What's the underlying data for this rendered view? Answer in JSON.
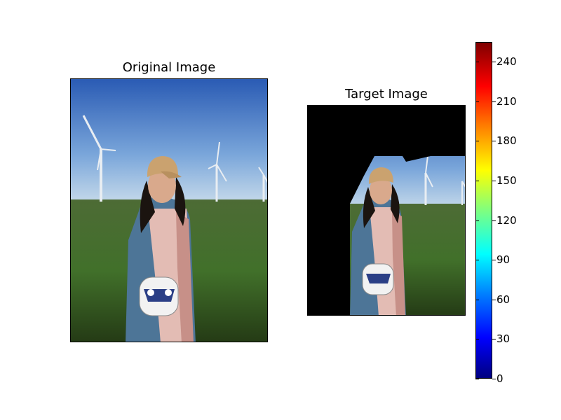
{
  "chart_data": [
    {
      "type": "image",
      "title": "Original Image",
      "content": "photo of a woman wearing a beige cap and a blue cardigan, holding a white bag, standing in a green field with wind turbines under a blue sky"
    },
    {
      "type": "image",
      "title": "Target Image",
      "content": "same photo cropped; left and upper-left region masked to black"
    },
    {
      "type": "colorbar",
      "colormap": "jet",
      "range": [
        0,
        255
      ],
      "ticks": [
        0,
        30,
        60,
        90,
        120,
        150,
        180,
        210,
        240
      ]
    }
  ],
  "colors": {
    "sky_top": "#2f64b8",
    "sky_horizon": "#bcd6e8",
    "grass": "#3f6a22",
    "mask": "#000000"
  }
}
